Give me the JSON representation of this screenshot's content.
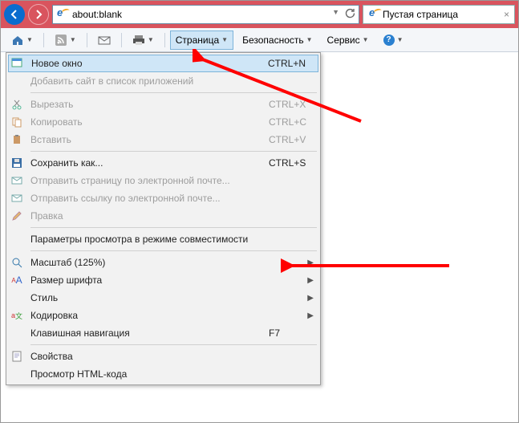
{
  "address_bar": {
    "url": "about:blank"
  },
  "tab": {
    "title": "Пустая страница"
  },
  "cmdbar": {
    "page": "Страница",
    "security": "Безопасность",
    "service": "Сервис"
  },
  "menu": {
    "new_window": "Новое окно",
    "new_window_sc": "CTRL+N",
    "add_site": "Добавить сайт в список приложений",
    "cut": "Вырезать",
    "cut_sc": "CTRL+X",
    "copy": "Копировать",
    "copy_sc": "CTRL+C",
    "paste": "Вставить",
    "paste_sc": "CTRL+V",
    "save_as": "Сохранить как...",
    "save_as_sc": "CTRL+S",
    "send_page": "Отправить страницу по электронной почте...",
    "send_link": "Отправить ссылку по электронной почте...",
    "edit": "Правка",
    "compat": "Параметры просмотра в режиме совместимости",
    "zoom": "Масштаб (125%)",
    "font_size": "Размер шрифта",
    "style": "Стиль",
    "encoding": "Кодировка",
    "caret": "Клавишная навигация",
    "caret_sc": "F7",
    "properties": "Свойства",
    "view_source": "Просмотр HTML-кода"
  }
}
